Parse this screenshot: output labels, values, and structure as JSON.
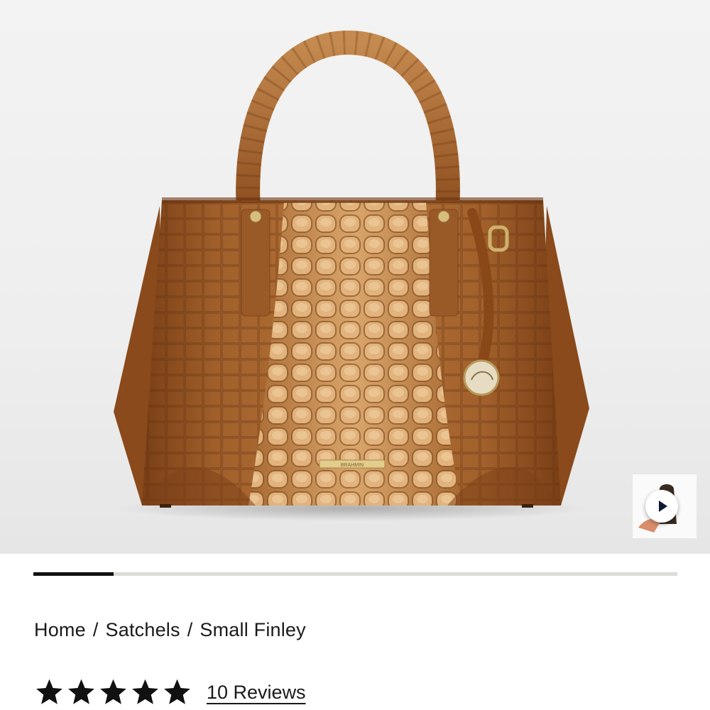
{
  "product_image": {
    "icon": "handbag-image",
    "zipper_plate_text": "BRAHMIN"
  },
  "video_thumbnail": {
    "icon": "play-icon"
  },
  "gallery_progress": {
    "fraction": 0.125
  },
  "breadcrumb": {
    "items": [
      {
        "label": "Home"
      },
      {
        "label": "Satchels"
      },
      {
        "label": "Small Finley"
      }
    ],
    "separator": "/"
  },
  "rating": {
    "stars": 5,
    "max": 5,
    "reviews_label": "10 Reviews"
  },
  "colors": {
    "accent": "#111111",
    "leather": "#a2612c",
    "hardware": "#c9a862",
    "track": "#dcdcd6"
  }
}
